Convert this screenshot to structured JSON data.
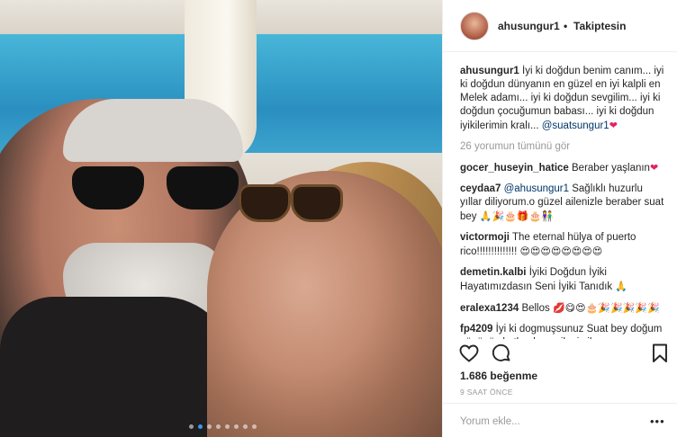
{
  "post": {
    "username": "ahusungur1",
    "separator": "•",
    "follow_status": "Takiptesin"
  },
  "caption": {
    "username": "ahusungur1",
    "text": "İyi ki doğdun benim canım... iyi ki doğdun dünyanın en güzel en iyi kalpli en Melek adamı... iyi ki doğdun sevgilim... iyi ki doğdun çocuğumun babası... iyi ki doğdun iyikilerimin kralı... ",
    "mention": "@suatsungur1",
    "emoji": "❤"
  },
  "view_all": "26 yorumun tümünü gör",
  "comments": [
    {
      "username": "gocer_huseyin_hatice",
      "text": "Beraber yaşlanın",
      "emoji": "❤"
    },
    {
      "username": "ceydaa7",
      "mention": "@ahusungur1",
      "text": " Sağlıklı huzurlu yıllar diliyorum.o güzel ailenizle beraber suat bey ",
      "emoji": "🙏🎉🎂🎁🎂👫"
    },
    {
      "username": "victormoji",
      "text": "The eternal hülya of puerto rico!!!!!!!!!!!!!! ",
      "emoji": "😍😍😍😍😍😍😍😍"
    },
    {
      "username": "demetin.kalbi",
      "text": "İyiki Doğdun İyiki Hayatımızdasın Seni İyiki Tanıdık ",
      "emoji": "🙏"
    },
    {
      "username": "eralexa1234",
      "text": "Bellos ",
      "emoji": "💋😋😍🎂🎉🎉🎉🎉🎉"
    },
    {
      "username": "fp4209",
      "text": "İyi ki dogmuşsunuz Suat bey doğum gününüz kutlu olsun aileniz ile"
    }
  ],
  "actions": {
    "like_icon": "heart-outline-icon",
    "comment_icon": "comment-bubble-icon",
    "save_icon": "bookmark-icon"
  },
  "likes": "1.686 beğenme",
  "time": "9 SAAT ÖNCE",
  "add_comment_placeholder": "Yorum ekle...",
  "more_label": "•••",
  "carousel": {
    "count": 8,
    "active_index": 1
  },
  "colors": {
    "link": "#003569",
    "muted": "#999999",
    "dot_active": "#3897f0"
  }
}
